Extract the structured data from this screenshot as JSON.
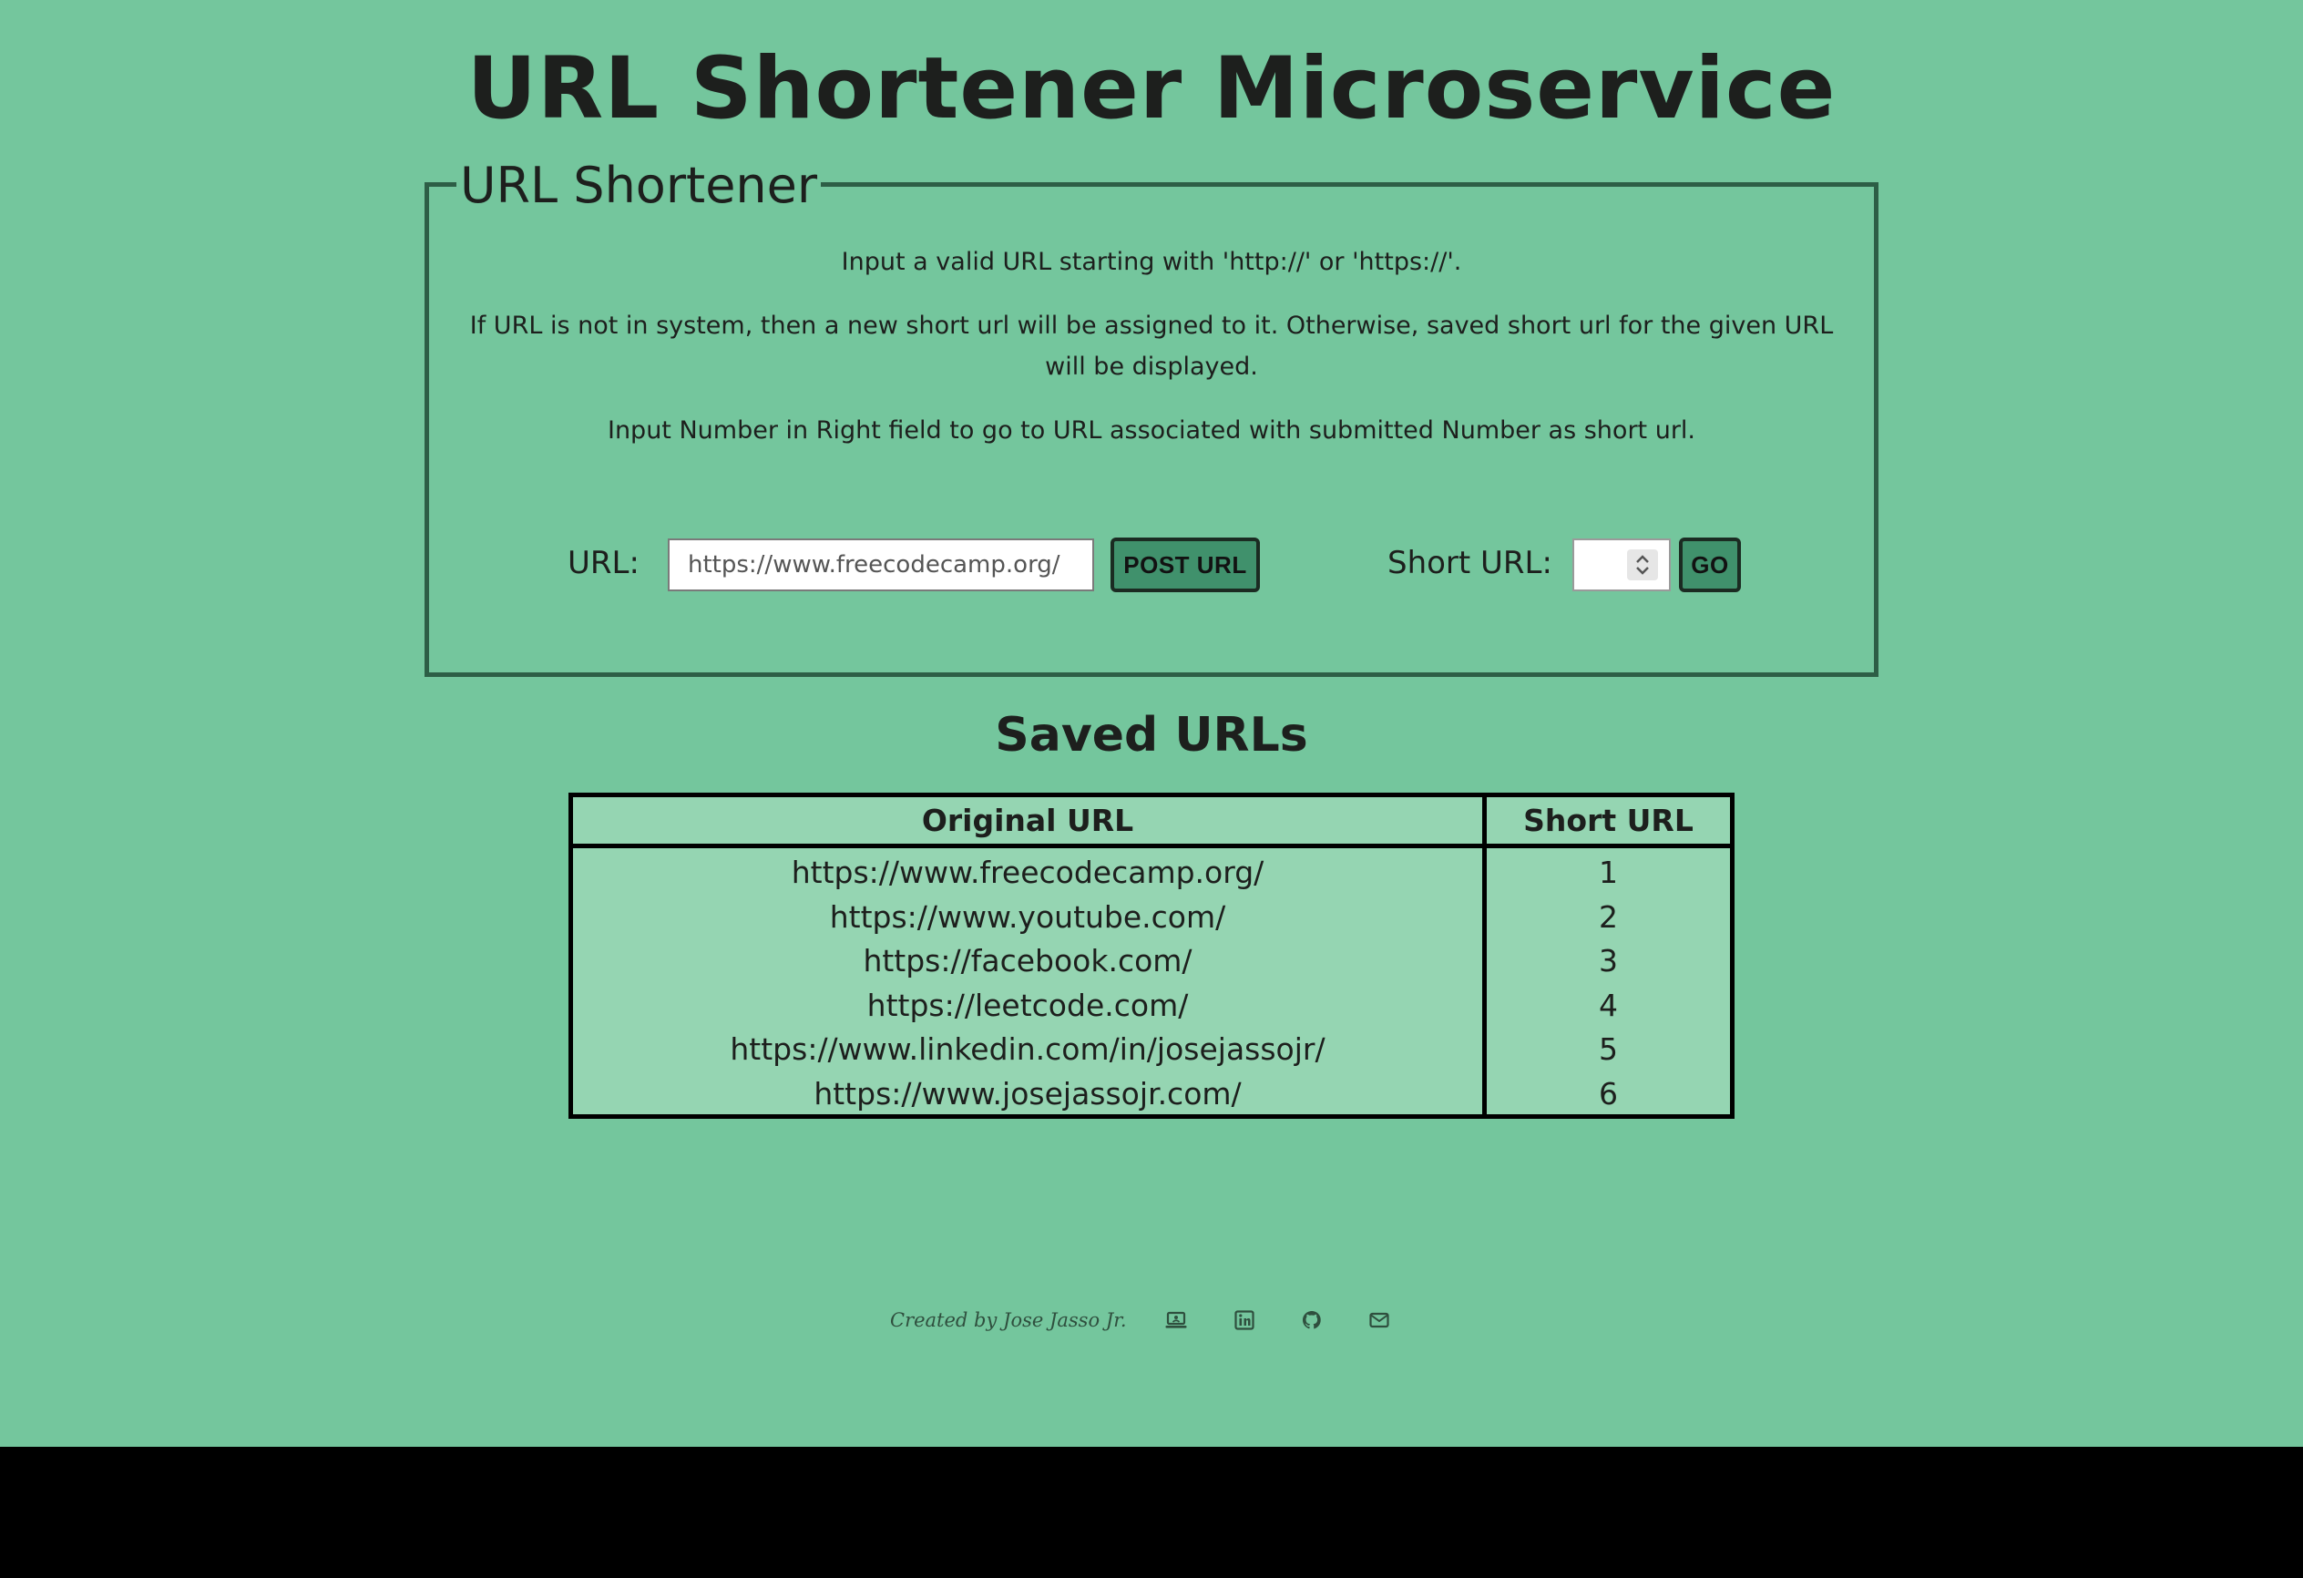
{
  "page": {
    "title": "URL Shortener Microservice"
  },
  "shortener": {
    "legend": "URL Shortener",
    "description": [
      "Input a valid URL starting with 'http://' or 'https://'.",
      "If URL is not in system, then a new short url will be assigned to it. Otherwise, saved short url for the given URL will be displayed.",
      "Input Number in Right field to go to URL associated with submitted Number as short url."
    ],
    "url_label": "URL:",
    "url_placeholder": "https://www.freecodecamp.org/",
    "post_button": "POST URL",
    "short_label": "Short URL:",
    "go_button": "GO"
  },
  "saved": {
    "title": "Saved URLs",
    "headers": [
      "Original URL",
      "Short URL"
    ],
    "rows": [
      {
        "original": "https://www.freecodecamp.org/",
        "short": "1"
      },
      {
        "original": "https://www.youtube.com/",
        "short": "2"
      },
      {
        "original": "https://facebook.com/",
        "short": "3"
      },
      {
        "original": "https://leetcode.com/",
        "short": "4"
      },
      {
        "original": "https://www.linkedin.com/in/josejassojr/",
        "short": "5"
      },
      {
        "original": "https://www.josejassojr.com/",
        "short": "6"
      }
    ]
  },
  "footer": {
    "credit": "Created by Jose Jasso Jr.",
    "icons": [
      "portfolio-icon",
      "linkedin-icon",
      "github-icon",
      "email-icon"
    ]
  },
  "colors": {
    "background": "#74c69d",
    "table_bg": "#95d5b2",
    "button_bg": "#40916c",
    "border_dark": "#2d5e46",
    "text": "#1d1f1d"
  }
}
